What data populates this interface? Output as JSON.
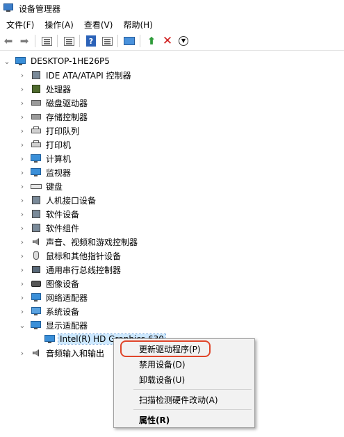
{
  "window": {
    "title": "设备管理器"
  },
  "menubar": {
    "items": [
      "文件(F)",
      "操作(A)",
      "查看(V)",
      "帮助(H)"
    ]
  },
  "tree": {
    "root": "DESKTOP-1HE26P5",
    "items": [
      {
        "label": "IDE ATA/ATAPI 控制器",
        "icon": "ide-controller-icon"
      },
      {
        "label": "处理器",
        "icon": "processor-icon"
      },
      {
        "label": "磁盘驱动器",
        "icon": "disk-drive-icon"
      },
      {
        "label": "存储控制器",
        "icon": "storage-controller-icon"
      },
      {
        "label": "打印队列",
        "icon": "print-queue-icon"
      },
      {
        "label": "打印机",
        "icon": "printer-icon"
      },
      {
        "label": "计算机",
        "icon": "computer-icon"
      },
      {
        "label": "监视器",
        "icon": "monitor-icon"
      },
      {
        "label": "键盘",
        "icon": "keyboard-icon"
      },
      {
        "label": "人机接口设备",
        "icon": "hid-icon"
      },
      {
        "label": "软件设备",
        "icon": "software-device-icon"
      },
      {
        "label": "软件组件",
        "icon": "software-component-icon"
      },
      {
        "label": "声音、视频和游戏控制器",
        "icon": "sound-video-icon"
      },
      {
        "label": "鼠标和其他指针设备",
        "icon": "mouse-icon"
      },
      {
        "label": "通用串行总线控制器",
        "icon": "usb-controller-icon"
      },
      {
        "label": "图像设备",
        "icon": "imaging-device-icon"
      },
      {
        "label": "网络适配器",
        "icon": "network-adapter-icon"
      },
      {
        "label": "系统设备",
        "icon": "system-device-icon"
      },
      {
        "label": "显示适配器",
        "icon": "display-adapter-icon"
      }
    ],
    "child": "Intel(R) HD Graphics 630",
    "last": "音频输入和输出"
  },
  "context_menu": {
    "update_driver": "更新驱动程序(P)",
    "disable_device": "禁用设备(D)",
    "uninstall_device": "卸载设备(U)",
    "scan_hardware": "扫描检测硬件改动(A)",
    "properties": "属性(R)"
  },
  "colors": {
    "highlight_ring": "#e0452a",
    "selection": "#cce8ff"
  }
}
